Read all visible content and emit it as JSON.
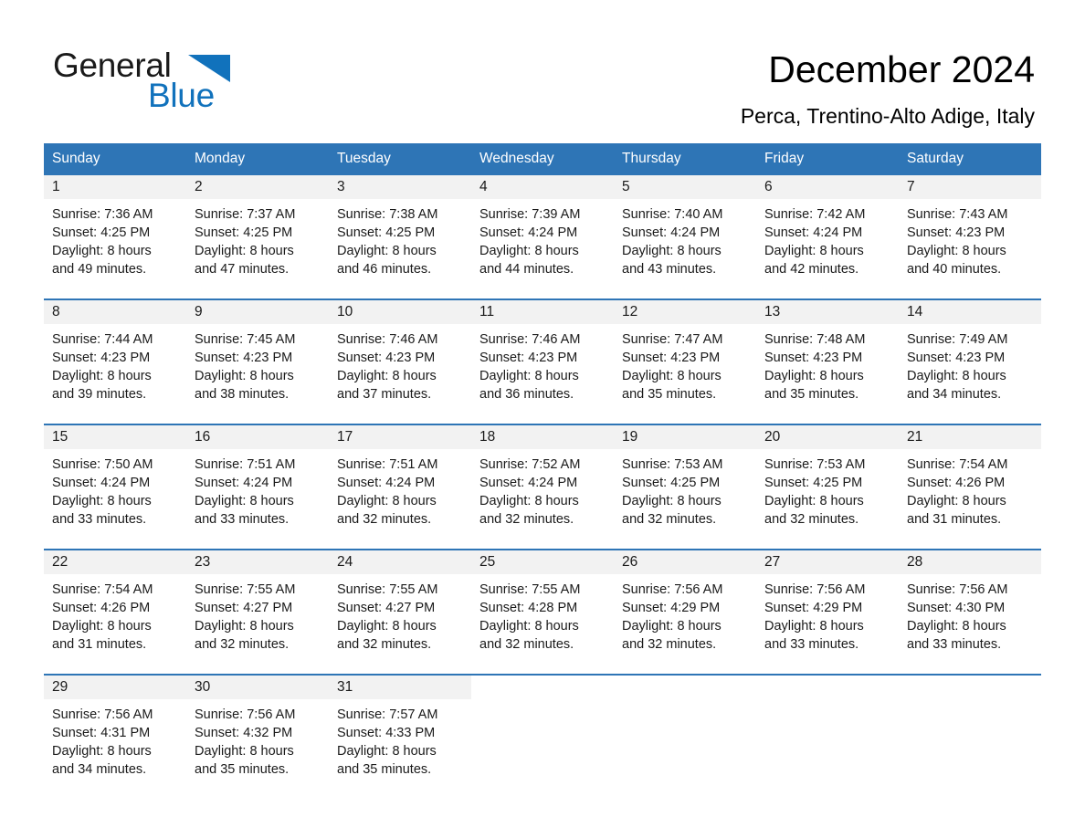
{
  "brand": {
    "name_part1": "General",
    "name_part2": "Blue",
    "accent_color": "#1172BC",
    "triangle_icon": "brand-triangle-icon"
  },
  "header": {
    "title": "December 2024",
    "subtitle": "Perca, Trentino-Alto Adige, Italy"
  },
  "calendar": {
    "header_bg_color": "#2E75B6",
    "daynum_bg_color": "#F2F2F2",
    "weekday_headers": [
      "Sunday",
      "Monday",
      "Tuesday",
      "Wednesday",
      "Thursday",
      "Friday",
      "Saturday"
    ],
    "weeks": [
      [
        {
          "day": "1",
          "sunrise": "Sunrise: 7:36 AM",
          "sunset": "Sunset: 4:25 PM",
          "daylight_line1": "Daylight: 8 hours",
          "daylight_line2": "and 49 minutes."
        },
        {
          "day": "2",
          "sunrise": "Sunrise: 7:37 AM",
          "sunset": "Sunset: 4:25 PM",
          "daylight_line1": "Daylight: 8 hours",
          "daylight_line2": "and 47 minutes."
        },
        {
          "day": "3",
          "sunrise": "Sunrise: 7:38 AM",
          "sunset": "Sunset: 4:25 PM",
          "daylight_line1": "Daylight: 8 hours",
          "daylight_line2": "and 46 minutes."
        },
        {
          "day": "4",
          "sunrise": "Sunrise: 7:39 AM",
          "sunset": "Sunset: 4:24 PM",
          "daylight_line1": "Daylight: 8 hours",
          "daylight_line2": "and 44 minutes."
        },
        {
          "day": "5",
          "sunrise": "Sunrise: 7:40 AM",
          "sunset": "Sunset: 4:24 PM",
          "daylight_line1": "Daylight: 8 hours",
          "daylight_line2": "and 43 minutes."
        },
        {
          "day": "6",
          "sunrise": "Sunrise: 7:42 AM",
          "sunset": "Sunset: 4:24 PM",
          "daylight_line1": "Daylight: 8 hours",
          "daylight_line2": "and 42 minutes."
        },
        {
          "day": "7",
          "sunrise": "Sunrise: 7:43 AM",
          "sunset": "Sunset: 4:23 PM",
          "daylight_line1": "Daylight: 8 hours",
          "daylight_line2": "and 40 minutes."
        }
      ],
      [
        {
          "day": "8",
          "sunrise": "Sunrise: 7:44 AM",
          "sunset": "Sunset: 4:23 PM",
          "daylight_line1": "Daylight: 8 hours",
          "daylight_line2": "and 39 minutes."
        },
        {
          "day": "9",
          "sunrise": "Sunrise: 7:45 AM",
          "sunset": "Sunset: 4:23 PM",
          "daylight_line1": "Daylight: 8 hours",
          "daylight_line2": "and 38 minutes."
        },
        {
          "day": "10",
          "sunrise": "Sunrise: 7:46 AM",
          "sunset": "Sunset: 4:23 PM",
          "daylight_line1": "Daylight: 8 hours",
          "daylight_line2": "and 37 minutes."
        },
        {
          "day": "11",
          "sunrise": "Sunrise: 7:46 AM",
          "sunset": "Sunset: 4:23 PM",
          "daylight_line1": "Daylight: 8 hours",
          "daylight_line2": "and 36 minutes."
        },
        {
          "day": "12",
          "sunrise": "Sunrise: 7:47 AM",
          "sunset": "Sunset: 4:23 PM",
          "daylight_line1": "Daylight: 8 hours",
          "daylight_line2": "and 35 minutes."
        },
        {
          "day": "13",
          "sunrise": "Sunrise: 7:48 AM",
          "sunset": "Sunset: 4:23 PM",
          "daylight_line1": "Daylight: 8 hours",
          "daylight_line2": "and 35 minutes."
        },
        {
          "day": "14",
          "sunrise": "Sunrise: 7:49 AM",
          "sunset": "Sunset: 4:23 PM",
          "daylight_line1": "Daylight: 8 hours",
          "daylight_line2": "and 34 minutes."
        }
      ],
      [
        {
          "day": "15",
          "sunrise": "Sunrise: 7:50 AM",
          "sunset": "Sunset: 4:24 PM",
          "daylight_line1": "Daylight: 8 hours",
          "daylight_line2": "and 33 minutes."
        },
        {
          "day": "16",
          "sunrise": "Sunrise: 7:51 AM",
          "sunset": "Sunset: 4:24 PM",
          "daylight_line1": "Daylight: 8 hours",
          "daylight_line2": "and 33 minutes."
        },
        {
          "day": "17",
          "sunrise": "Sunrise: 7:51 AM",
          "sunset": "Sunset: 4:24 PM",
          "daylight_line1": "Daylight: 8 hours",
          "daylight_line2": "and 32 minutes."
        },
        {
          "day": "18",
          "sunrise": "Sunrise: 7:52 AM",
          "sunset": "Sunset: 4:24 PM",
          "daylight_line1": "Daylight: 8 hours",
          "daylight_line2": "and 32 minutes."
        },
        {
          "day": "19",
          "sunrise": "Sunrise: 7:53 AM",
          "sunset": "Sunset: 4:25 PM",
          "daylight_line1": "Daylight: 8 hours",
          "daylight_line2": "and 32 minutes."
        },
        {
          "day": "20",
          "sunrise": "Sunrise: 7:53 AM",
          "sunset": "Sunset: 4:25 PM",
          "daylight_line1": "Daylight: 8 hours",
          "daylight_line2": "and 32 minutes."
        },
        {
          "day": "21",
          "sunrise": "Sunrise: 7:54 AM",
          "sunset": "Sunset: 4:26 PM",
          "daylight_line1": "Daylight: 8 hours",
          "daylight_line2": "and 31 minutes."
        }
      ],
      [
        {
          "day": "22",
          "sunrise": "Sunrise: 7:54 AM",
          "sunset": "Sunset: 4:26 PM",
          "daylight_line1": "Daylight: 8 hours",
          "daylight_line2": "and 31 minutes."
        },
        {
          "day": "23",
          "sunrise": "Sunrise: 7:55 AM",
          "sunset": "Sunset: 4:27 PM",
          "daylight_line1": "Daylight: 8 hours",
          "daylight_line2": "and 32 minutes."
        },
        {
          "day": "24",
          "sunrise": "Sunrise: 7:55 AM",
          "sunset": "Sunset: 4:27 PM",
          "daylight_line1": "Daylight: 8 hours",
          "daylight_line2": "and 32 minutes."
        },
        {
          "day": "25",
          "sunrise": "Sunrise: 7:55 AM",
          "sunset": "Sunset: 4:28 PM",
          "daylight_line1": "Daylight: 8 hours",
          "daylight_line2": "and 32 minutes."
        },
        {
          "day": "26",
          "sunrise": "Sunrise: 7:56 AM",
          "sunset": "Sunset: 4:29 PM",
          "daylight_line1": "Daylight: 8 hours",
          "daylight_line2": "and 32 minutes."
        },
        {
          "day": "27",
          "sunrise": "Sunrise: 7:56 AM",
          "sunset": "Sunset: 4:29 PM",
          "daylight_line1": "Daylight: 8 hours",
          "daylight_line2": "and 33 minutes."
        },
        {
          "day": "28",
          "sunrise": "Sunrise: 7:56 AM",
          "sunset": "Sunset: 4:30 PM",
          "daylight_line1": "Daylight: 8 hours",
          "daylight_line2": "and 33 minutes."
        }
      ],
      [
        {
          "day": "29",
          "sunrise": "Sunrise: 7:56 AM",
          "sunset": "Sunset: 4:31 PM",
          "daylight_line1": "Daylight: 8 hours",
          "daylight_line2": "and 34 minutes."
        },
        {
          "day": "30",
          "sunrise": "Sunrise: 7:56 AM",
          "sunset": "Sunset: 4:32 PM",
          "daylight_line1": "Daylight: 8 hours",
          "daylight_line2": "and 35 minutes."
        },
        {
          "day": "31",
          "sunrise": "Sunrise: 7:57 AM",
          "sunset": "Sunset: 4:33 PM",
          "daylight_line1": "Daylight: 8 hours",
          "daylight_line2": "and 35 minutes."
        },
        {
          "day": "",
          "sunrise": "",
          "sunset": "",
          "daylight_line1": "",
          "daylight_line2": ""
        },
        {
          "day": "",
          "sunrise": "",
          "sunset": "",
          "daylight_line1": "",
          "daylight_line2": ""
        },
        {
          "day": "",
          "sunrise": "",
          "sunset": "",
          "daylight_line1": "",
          "daylight_line2": ""
        },
        {
          "day": "",
          "sunrise": "",
          "sunset": "",
          "daylight_line1": "",
          "daylight_line2": ""
        }
      ]
    ]
  }
}
